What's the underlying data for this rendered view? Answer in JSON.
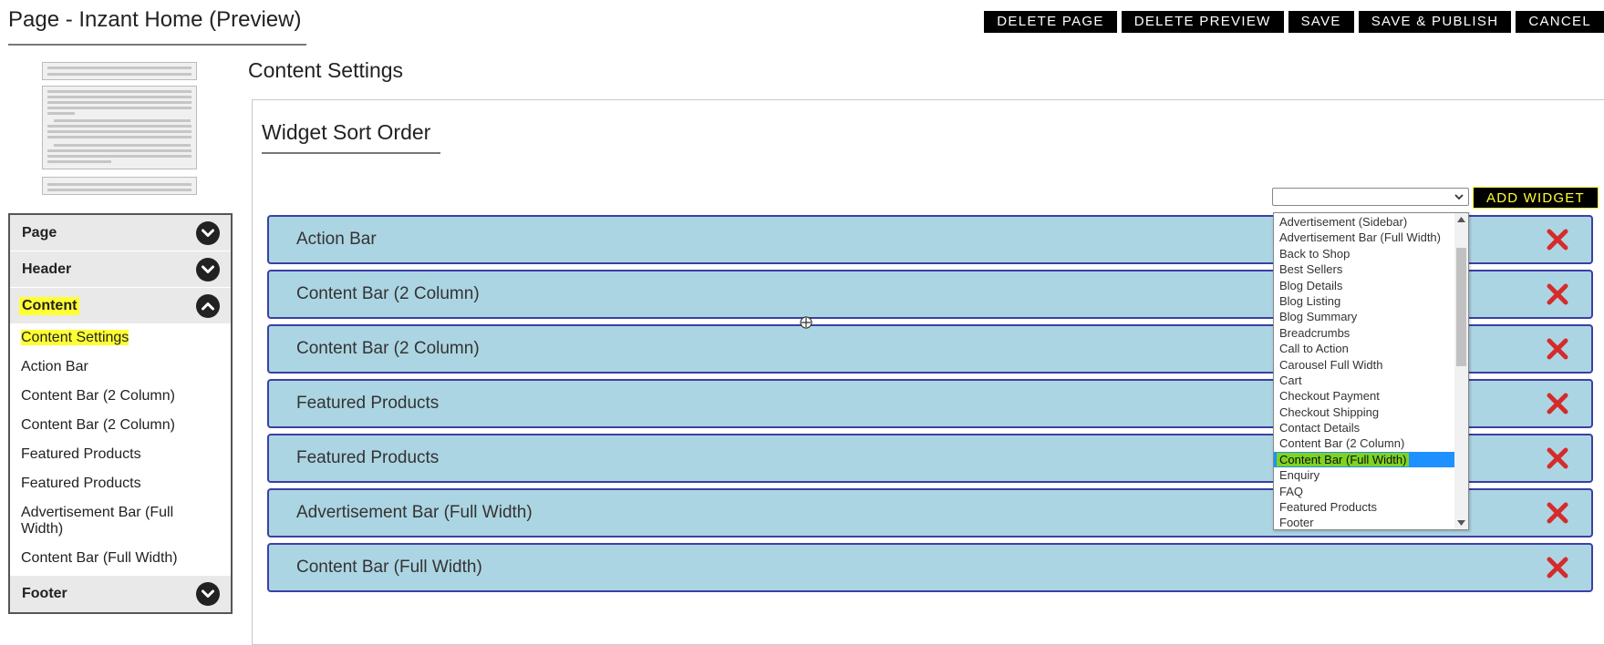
{
  "header": {
    "title": "Page - Inzant Home (Preview)"
  },
  "toolbar": {
    "buttons": [
      {
        "name": "delete-page-button",
        "label": "DELETE PAGE"
      },
      {
        "name": "delete-preview-button",
        "label": "DELETE PREVIEW"
      },
      {
        "name": "save-button",
        "label": "SAVE"
      },
      {
        "name": "save-publish-button",
        "label": "SAVE & PUBLISH"
      },
      {
        "name": "cancel-button",
        "label": "CANCEL"
      }
    ]
  },
  "sidebar": {
    "page": "Page",
    "header": "Header",
    "content": "Content",
    "footer": "Footer",
    "content_items": [
      "Content Settings",
      "Action Bar",
      "Content Bar (2 Column)",
      "Content Bar (2 Column)",
      "Featured Products",
      "Featured Products",
      "Advertisement Bar (Full Width)",
      "Content Bar (Full Width)"
    ]
  },
  "main": {
    "section_title": "Content Settings",
    "widget_sort_title": "Widget Sort Order",
    "add_widget_label": "ADD WIDGET",
    "widgets": [
      "Action Bar",
      "Content Bar (2 Column)",
      "Content Bar (2 Column)",
      "Featured Products",
      "Featured Products",
      "Advertisement Bar (Full Width)",
      "Content Bar (Full Width)"
    ],
    "dropdown_options": [
      "Advertisement (Sidebar)",
      "Advertisement Bar (Full Width)",
      "Back to Shop",
      "Best Sellers",
      "Blog Details",
      "Blog Listing",
      "Blog Summary",
      "Breadcrumbs",
      "Call to Action",
      "Carousel Full Width",
      "Cart",
      "Checkout Payment",
      "Checkout Shipping",
      "Contact Details",
      "Content Bar (2 Column)",
      "Content Bar (Full Width)",
      "Enquiry",
      "FAQ",
      "Featured Products",
      "Footer"
    ],
    "selected_option": "Content Bar (Full Width)"
  },
  "colors": {
    "highlight": "#ffff33",
    "widget_bg": "#acd5e3",
    "widget_border": "#3c3fa6",
    "delete_x": "#d62b2b",
    "option_selected": "#1e90ff"
  }
}
